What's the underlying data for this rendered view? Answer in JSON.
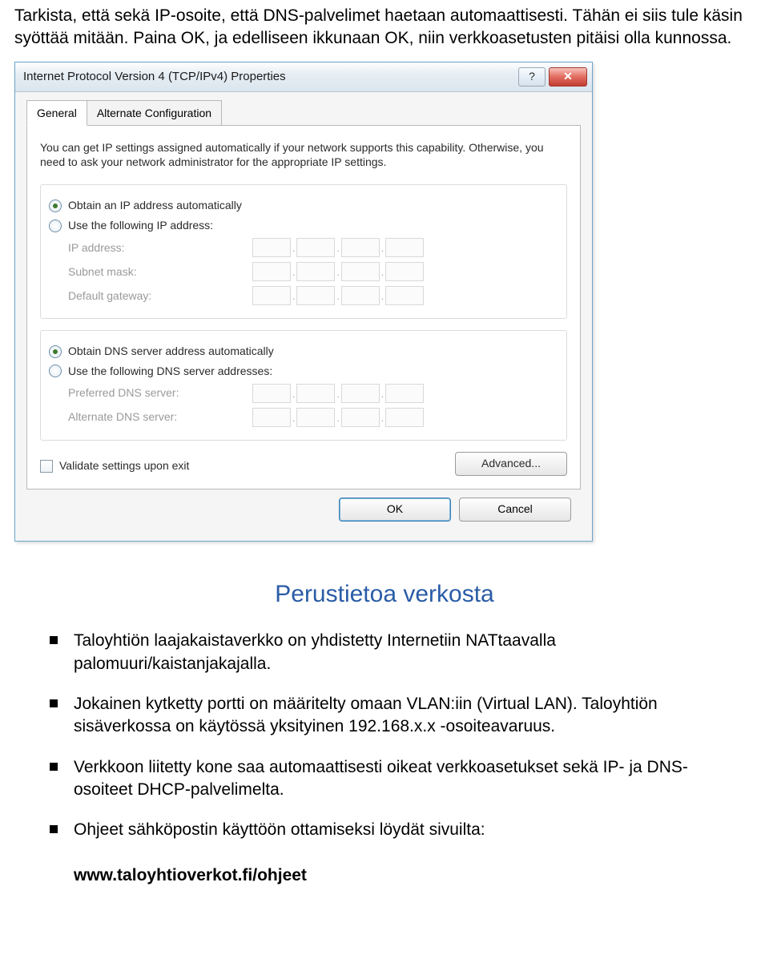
{
  "intro": "Tarkista, että sekä IP-osoite, että DNS-palvelimet haetaan automaattisesti. Tähän ei siis tule käsin syöttää mitään. Paina OK, ja edelliseen ikkunaan OK, niin verkkoasetusten pitäisi olla kunnossa.",
  "dialog": {
    "title": "Internet Protocol Version 4 (TCP/IPv4) Properties",
    "tabs": {
      "general": "General",
      "alt": "Alternate Configuration"
    },
    "desc": "You can get IP settings assigned automatically if your network supports this capability. Otherwise, you need to ask your network administrator for the appropriate IP settings.",
    "radio_ip_auto": "Obtain an IP address automatically",
    "radio_ip_manual": "Use the following IP address:",
    "ip_address": "IP address:",
    "subnet": "Subnet mask:",
    "gateway": "Default gateway:",
    "radio_dns_auto": "Obtain DNS server address automatically",
    "radio_dns_manual": "Use the following DNS server addresses:",
    "pref_dns": "Preferred DNS server:",
    "alt_dns": "Alternate DNS server:",
    "validate": "Validate settings upon exit",
    "advanced": "Advanced...",
    "ok": "OK",
    "cancel": "Cancel"
  },
  "section_title": "Perustietoa verkosta",
  "bullets": [
    "Taloyhtiön laajakaistaverkko on yhdistetty Internetiin NATtaavalla palomuuri/kaistanjakajalla.",
    "Jokainen kytketty portti on määritelty omaan VLAN:iin (Virtual LAN). Taloyhtiön sisäverkossa on käytössä yksityinen 192.168.x.x -osoiteavaruus.",
    "Verkkoon liitetty kone saa automaattisesti oikeat verkkoasetukset sekä IP- ja DNS-osoiteet DHCP-palvelimelta.",
    "Ohjeet sähköpostin käyttöön ottamiseksi löydät sivuilta:"
  ],
  "footer_url": "www.taloyhtioverkot.fi/ohjeet"
}
